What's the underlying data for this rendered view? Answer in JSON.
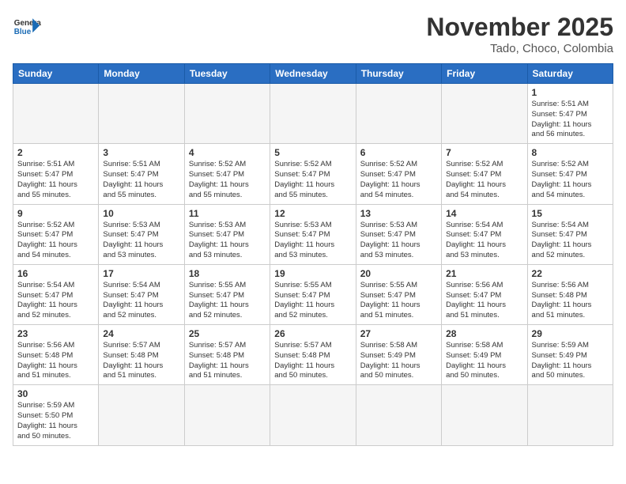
{
  "header": {
    "logo_general": "General",
    "logo_blue": "Blue",
    "month_title": "November 2025",
    "location": "Tado, Choco, Colombia"
  },
  "weekdays": [
    "Sunday",
    "Monday",
    "Tuesday",
    "Wednesday",
    "Thursday",
    "Friday",
    "Saturday"
  ],
  "weeks": [
    [
      {
        "day": "",
        "info": ""
      },
      {
        "day": "",
        "info": ""
      },
      {
        "day": "",
        "info": ""
      },
      {
        "day": "",
        "info": ""
      },
      {
        "day": "",
        "info": ""
      },
      {
        "day": "",
        "info": ""
      },
      {
        "day": "1",
        "info": "Sunrise: 5:51 AM\nSunset: 5:47 PM\nDaylight: 11 hours\nand 56 minutes."
      }
    ],
    [
      {
        "day": "2",
        "info": "Sunrise: 5:51 AM\nSunset: 5:47 PM\nDaylight: 11 hours\nand 55 minutes."
      },
      {
        "day": "3",
        "info": "Sunrise: 5:51 AM\nSunset: 5:47 PM\nDaylight: 11 hours\nand 55 minutes."
      },
      {
        "day": "4",
        "info": "Sunrise: 5:52 AM\nSunset: 5:47 PM\nDaylight: 11 hours\nand 55 minutes."
      },
      {
        "day": "5",
        "info": "Sunrise: 5:52 AM\nSunset: 5:47 PM\nDaylight: 11 hours\nand 55 minutes."
      },
      {
        "day": "6",
        "info": "Sunrise: 5:52 AM\nSunset: 5:47 PM\nDaylight: 11 hours\nand 54 minutes."
      },
      {
        "day": "7",
        "info": "Sunrise: 5:52 AM\nSunset: 5:47 PM\nDaylight: 11 hours\nand 54 minutes."
      },
      {
        "day": "8",
        "info": "Sunrise: 5:52 AM\nSunset: 5:47 PM\nDaylight: 11 hours\nand 54 minutes."
      }
    ],
    [
      {
        "day": "9",
        "info": "Sunrise: 5:52 AM\nSunset: 5:47 PM\nDaylight: 11 hours\nand 54 minutes."
      },
      {
        "day": "10",
        "info": "Sunrise: 5:53 AM\nSunset: 5:47 PM\nDaylight: 11 hours\nand 53 minutes."
      },
      {
        "day": "11",
        "info": "Sunrise: 5:53 AM\nSunset: 5:47 PM\nDaylight: 11 hours\nand 53 minutes."
      },
      {
        "day": "12",
        "info": "Sunrise: 5:53 AM\nSunset: 5:47 PM\nDaylight: 11 hours\nand 53 minutes."
      },
      {
        "day": "13",
        "info": "Sunrise: 5:53 AM\nSunset: 5:47 PM\nDaylight: 11 hours\nand 53 minutes."
      },
      {
        "day": "14",
        "info": "Sunrise: 5:54 AM\nSunset: 5:47 PM\nDaylight: 11 hours\nand 53 minutes."
      },
      {
        "day": "15",
        "info": "Sunrise: 5:54 AM\nSunset: 5:47 PM\nDaylight: 11 hours\nand 52 minutes."
      }
    ],
    [
      {
        "day": "16",
        "info": "Sunrise: 5:54 AM\nSunset: 5:47 PM\nDaylight: 11 hours\nand 52 minutes."
      },
      {
        "day": "17",
        "info": "Sunrise: 5:54 AM\nSunset: 5:47 PM\nDaylight: 11 hours\nand 52 minutes."
      },
      {
        "day": "18",
        "info": "Sunrise: 5:55 AM\nSunset: 5:47 PM\nDaylight: 11 hours\nand 52 minutes."
      },
      {
        "day": "19",
        "info": "Sunrise: 5:55 AM\nSunset: 5:47 PM\nDaylight: 11 hours\nand 52 minutes."
      },
      {
        "day": "20",
        "info": "Sunrise: 5:55 AM\nSunset: 5:47 PM\nDaylight: 11 hours\nand 51 minutes."
      },
      {
        "day": "21",
        "info": "Sunrise: 5:56 AM\nSunset: 5:47 PM\nDaylight: 11 hours\nand 51 minutes."
      },
      {
        "day": "22",
        "info": "Sunrise: 5:56 AM\nSunset: 5:48 PM\nDaylight: 11 hours\nand 51 minutes."
      }
    ],
    [
      {
        "day": "23",
        "info": "Sunrise: 5:56 AM\nSunset: 5:48 PM\nDaylight: 11 hours\nand 51 minutes."
      },
      {
        "day": "24",
        "info": "Sunrise: 5:57 AM\nSunset: 5:48 PM\nDaylight: 11 hours\nand 51 minutes."
      },
      {
        "day": "25",
        "info": "Sunrise: 5:57 AM\nSunset: 5:48 PM\nDaylight: 11 hours\nand 51 minutes."
      },
      {
        "day": "26",
        "info": "Sunrise: 5:57 AM\nSunset: 5:48 PM\nDaylight: 11 hours\nand 50 minutes."
      },
      {
        "day": "27",
        "info": "Sunrise: 5:58 AM\nSunset: 5:49 PM\nDaylight: 11 hours\nand 50 minutes."
      },
      {
        "day": "28",
        "info": "Sunrise: 5:58 AM\nSunset: 5:49 PM\nDaylight: 11 hours\nand 50 minutes."
      },
      {
        "day": "29",
        "info": "Sunrise: 5:59 AM\nSunset: 5:49 PM\nDaylight: 11 hours\nand 50 minutes."
      }
    ],
    [
      {
        "day": "30",
        "info": "Sunrise: 5:59 AM\nSunset: 5:50 PM\nDaylight: 11 hours\nand 50 minutes."
      },
      {
        "day": "",
        "info": ""
      },
      {
        "day": "",
        "info": ""
      },
      {
        "day": "",
        "info": ""
      },
      {
        "day": "",
        "info": ""
      },
      {
        "day": "",
        "info": ""
      },
      {
        "day": "",
        "info": ""
      }
    ]
  ]
}
